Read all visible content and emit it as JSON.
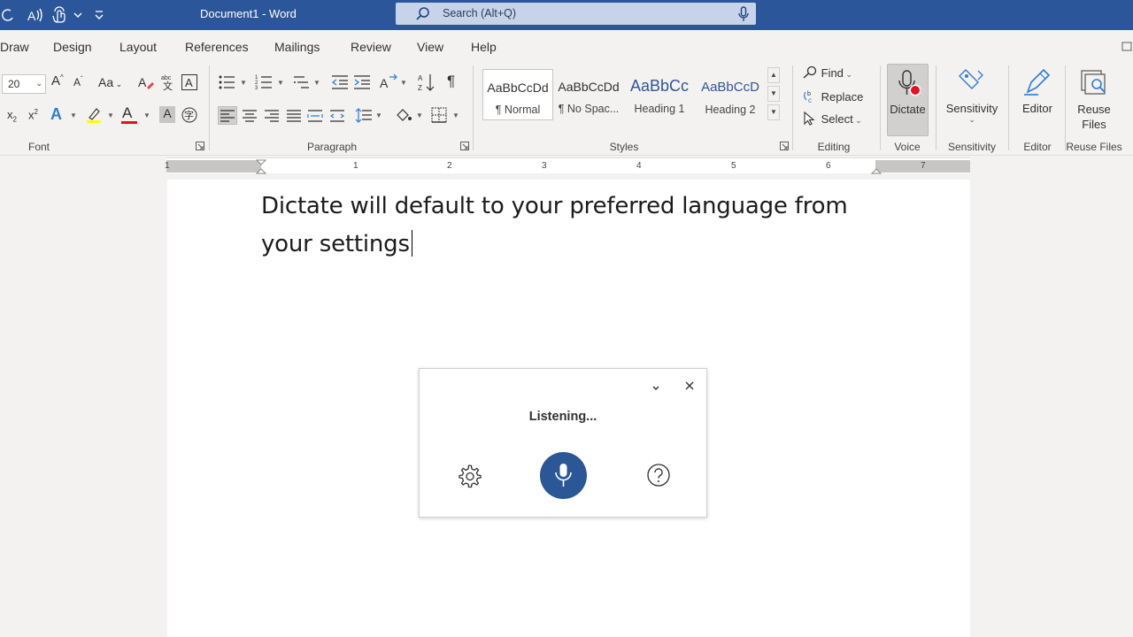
{
  "window": {
    "title": "Document1  -  Word",
    "search_placeholder": "Search (Alt+Q)"
  },
  "menu": {
    "tabs": [
      "Draw",
      "Design",
      "Layout",
      "References",
      "Mailings",
      "Review",
      "View",
      "Help"
    ]
  },
  "ribbon": {
    "font": {
      "size_value": "20",
      "group_label": "Font"
    },
    "paragraph": {
      "group_label": "Paragraph",
      "pilcrow": "¶"
    },
    "styles": {
      "group_label": "Styles",
      "items": [
        {
          "sample": "AaBbCcDd",
          "name": "¶ Normal"
        },
        {
          "sample": "AaBbCcDd",
          "name": "¶ No Spac..."
        },
        {
          "sample": "AaBbCc",
          "name": "Heading 1"
        },
        {
          "sample": "AaBbCcD",
          "name": "Heading 2"
        }
      ]
    },
    "editing": {
      "group_label": "Editing",
      "find": "Find",
      "replace": "Replace",
      "select": "Select"
    },
    "voice": {
      "group_label": "Voice",
      "dictate": "Dictate"
    },
    "sensitivity": {
      "group_label": "Sensitivity",
      "button": "Sensitivity"
    },
    "editor": {
      "group_label": "Editor",
      "button": "Editor"
    },
    "reuse": {
      "group_label": "Reuse Files",
      "button_line1": "Reuse",
      "button_line2": "Files"
    },
    "format_labels": {
      "font_size_grow": "A",
      "font_size_shrink": "A",
      "change_case": "Aa",
      "subscript": "x",
      "superscript": "x",
      "text_effects": "A",
      "font_color": "A",
      "char_shading": "A"
    }
  },
  "ruler": {
    "numbers": [
      "1",
      "1",
      "2",
      "3",
      "4",
      "5",
      "6",
      "7"
    ]
  },
  "document": {
    "text": "Dictate will default to your preferred language from your settings"
  },
  "dictation_panel": {
    "status": "Listening..."
  },
  "colors": {
    "titlebar": "#2b579a",
    "search_bg": "#c7d3ea",
    "mic_button": "#2b5797",
    "dictate_record": "#e81123",
    "highlight": "#ffff00",
    "font_color_bar": "#e81123"
  }
}
